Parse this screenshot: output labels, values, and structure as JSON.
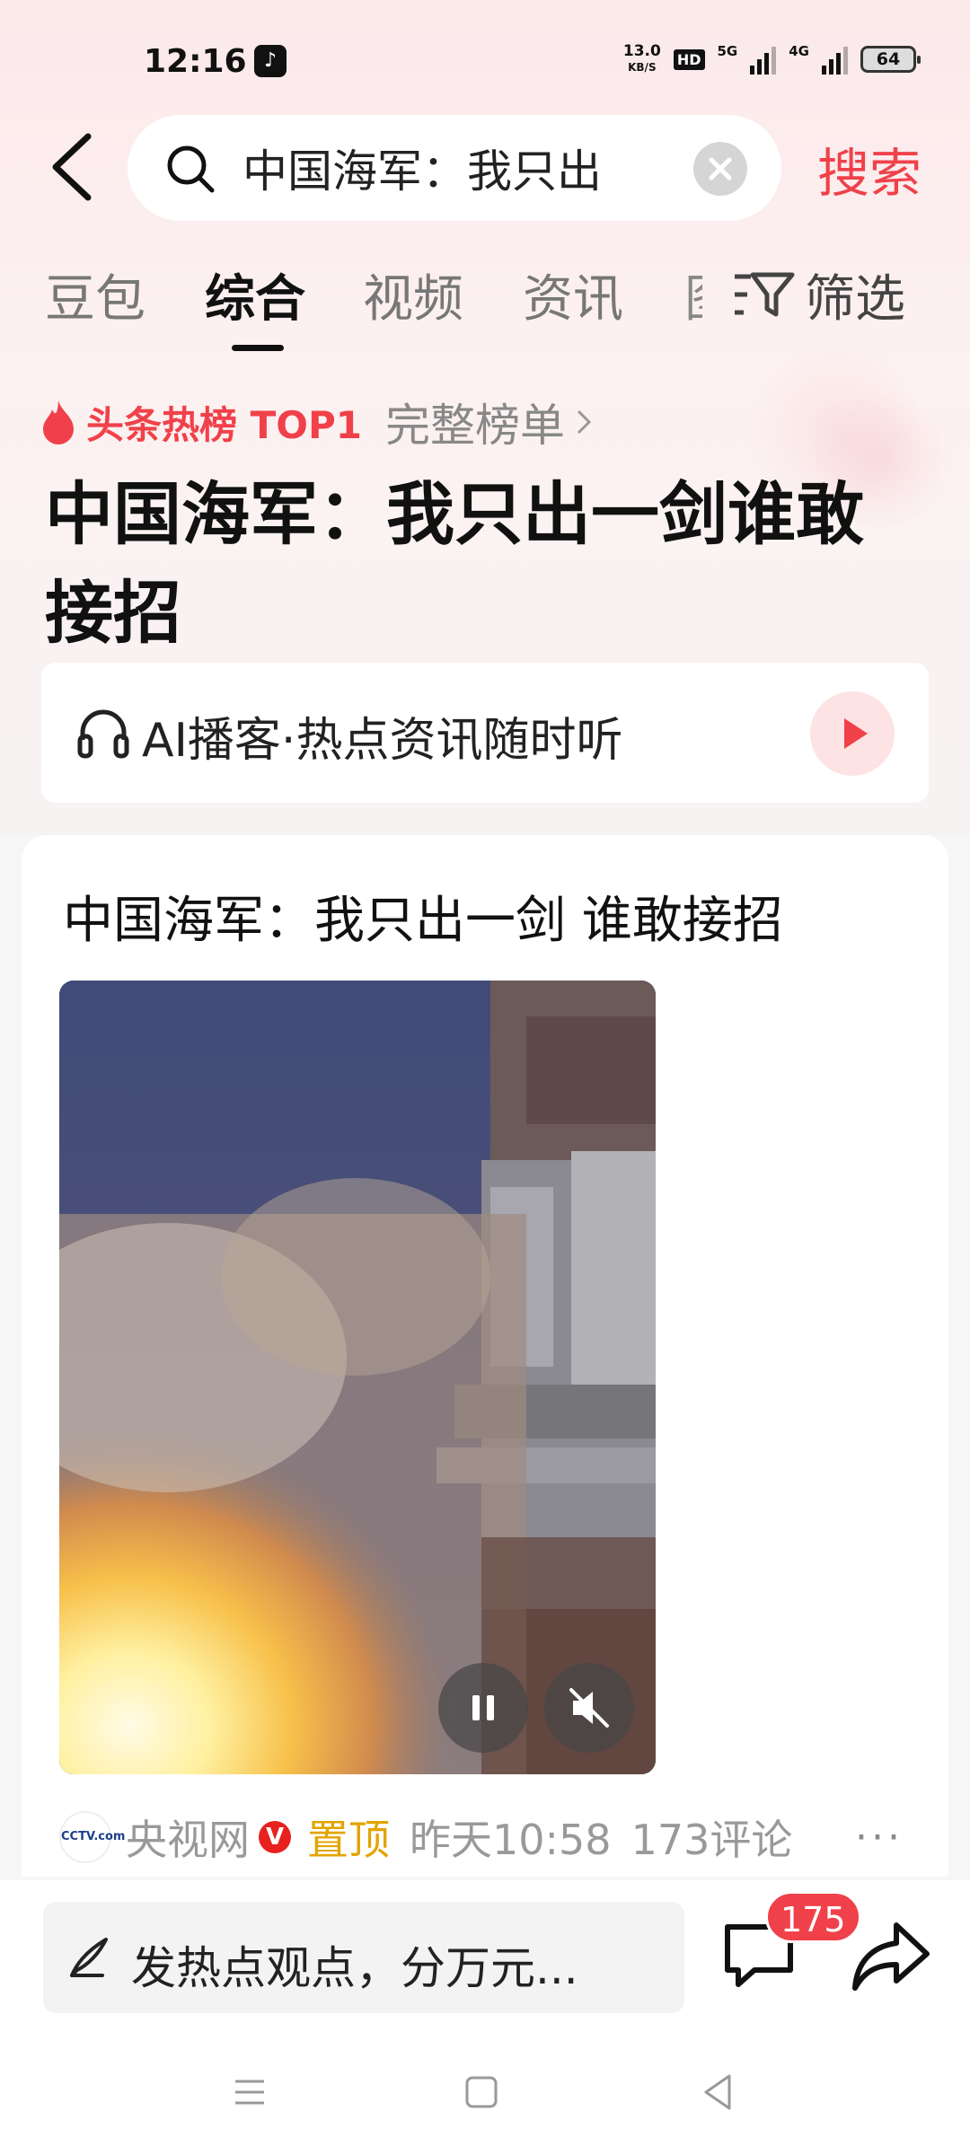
{
  "status_bar": {
    "time": "12:16",
    "app_icon": "tiktok-icon",
    "net_speed_value": "13.0",
    "net_speed_unit": "KB/S",
    "hd_label": "HD",
    "signal1_label": "5G",
    "signal2_label": "4G",
    "battery": "64"
  },
  "search": {
    "query": "中国海军：我只出",
    "button_label": "搜索"
  },
  "tabs": [
    {
      "label": "豆包",
      "active": false
    },
    {
      "label": "综合",
      "active": true
    },
    {
      "label": "视频",
      "active": false
    },
    {
      "label": "资讯",
      "active": false
    }
  ],
  "filter_label": "筛选",
  "hot": {
    "label": "头条热榜 TOP1",
    "full_list": "完整榜单",
    "headline": "中国海军：我只出一剑谁敢接招"
  },
  "podcast": {
    "text": "AI播客·热点资讯随时听"
  },
  "card": {
    "title": "中国海军：我只出一剑 谁敢接招",
    "source_logo": "CCTV.com",
    "source": "央视网",
    "verified": "V",
    "pinned": "置顶",
    "time": "昨天10:58",
    "comments": "173评论"
  },
  "bottom": {
    "comment_placeholder": "发热点观点，分万元...",
    "comment_count": "175"
  },
  "colors": {
    "accent": "#f0414a",
    "pinned": "#e3a400",
    "verified": "#e8201e"
  }
}
